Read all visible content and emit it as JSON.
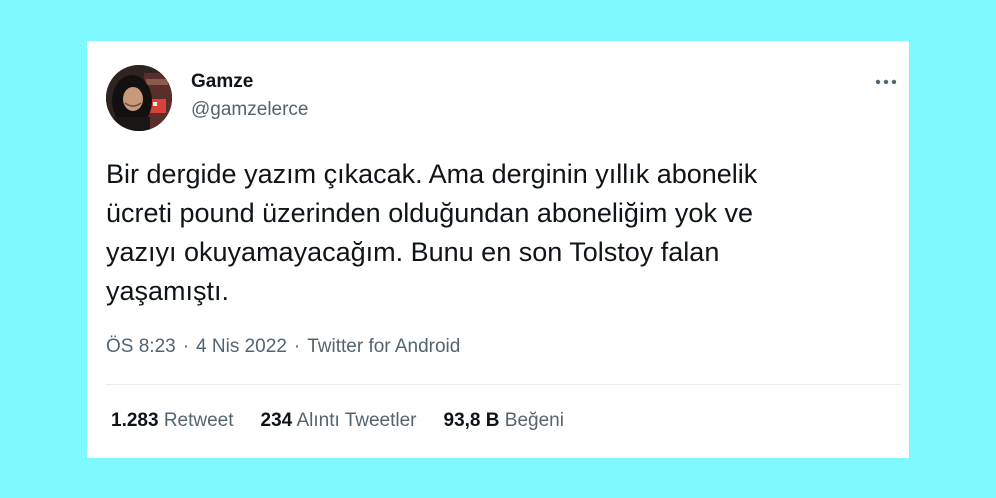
{
  "author": {
    "name": "Gamze",
    "handle": "@gamzelerce"
  },
  "tweet": {
    "text": "Bir dergide yazım çıkacak. Ama derginin yıllık abonelik\nücreti pound üzerinden olduğundan aboneliğim yok ve\nyazıyı okuyamayacağım. Bunu en son Tolstoy falan\nyaşamıştı."
  },
  "meta": {
    "time": "ÖS 8:23",
    "date": "4 Nis 2022",
    "separator": "·",
    "source": "Twitter for Android"
  },
  "stats": {
    "retweets": {
      "count": "1.283",
      "label": "Retweet"
    },
    "quotes": {
      "count": "234",
      "label": "Alıntı Tweetler"
    },
    "likes": {
      "count": "93,8 B",
      "label": "Beğeni"
    }
  },
  "icons": {
    "more": "more-dots-icon"
  },
  "colors": {
    "background": "#7ef9ff",
    "card": "#ffffff",
    "text_primary": "#0f1419",
    "text_secondary": "#536471",
    "divider": "#e6ecf0"
  }
}
